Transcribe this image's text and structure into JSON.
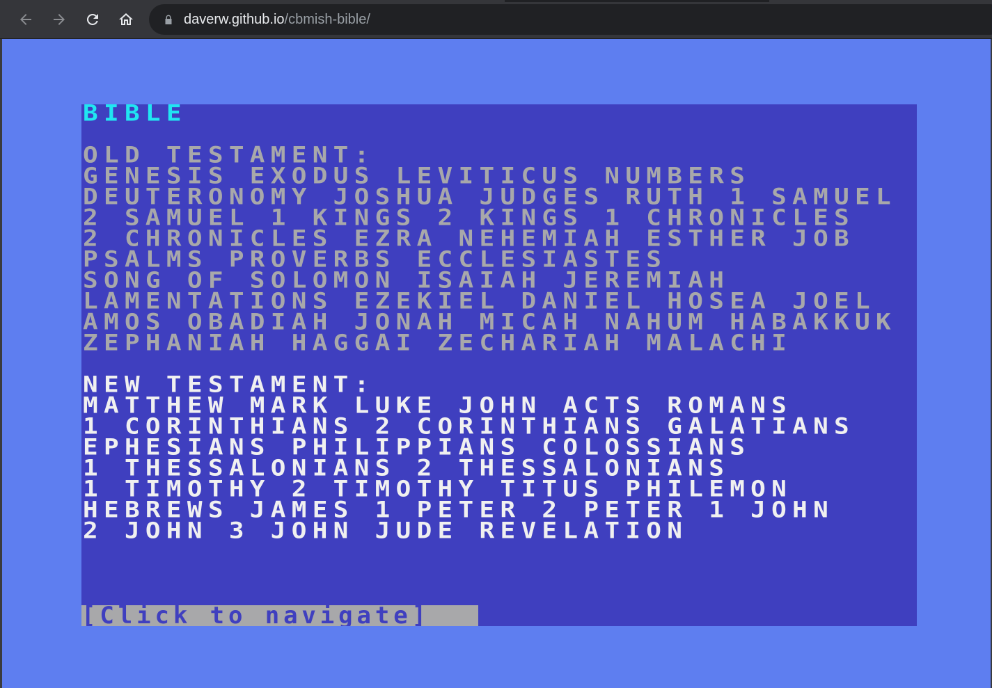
{
  "browser": {
    "url_host": "daverw.github.io",
    "url_path": "/cbmish-bible/",
    "back_icon": "back-arrow-icon",
    "forward_icon": "forward-arrow-icon",
    "reload_icon": "reload-icon",
    "home_icon": "home-icon",
    "lock_icon": "lock-icon"
  },
  "colors": {
    "page_bg": "#5e7ef0",
    "screen_bg": "#3f3fbf",
    "title": "#20e6f2",
    "old_testament": "#a8a8aa",
    "new_testament": "#f0f0f0"
  },
  "screen": {
    "title": "BIBLE",
    "old_testament": {
      "heading": "OLD TESTAMENT:",
      "lines": [
        "GENESIS EXODUS LEVITICUS NUMBERS",
        "DEUTERONOMY JOSHUA JUDGES RUTH 1 SAMUEL",
        "2 SAMUEL 1 KINGS 2 KINGS 1 CHRONICLES",
        "2 CHRONICLES EZRA NEHEMIAH ESTHER JOB",
        "PSALMS PROVERBS ECCLESIASTES",
        "SONG OF SOLOMON ISAIAH JEREMIAH",
        "LAMENTATIONS EZEKIEL DANIEL HOSEA JOEL",
        "AMOS OBADIAH JONAH MICAH NAHUM HABAKKUK",
        "ZEPHANIAH HAGGAI ZECHARIAH MALACHI"
      ]
    },
    "new_testament": {
      "heading": "NEW TESTAMENT:",
      "lines": [
        "MATTHEW MARK LUKE JOHN ACTS ROMANS",
        "1 CORINTHIANS 2 CORINTHIANS GALATIANS",
        "EPHESIANS PHILIPPIANS COLOSSIANS",
        "1 THESSALONIANS 2 THESSALONIANS",
        "1 TIMOTHY 2 TIMOTHY TITUS PHILEMON",
        "HEBREWS JAMES 1 PETER 2 PETER 1 JOHN",
        "2 JOHN 3 JOHN JUDE REVELATION"
      ]
    },
    "nav_prompt": "[Click to navigate]"
  }
}
